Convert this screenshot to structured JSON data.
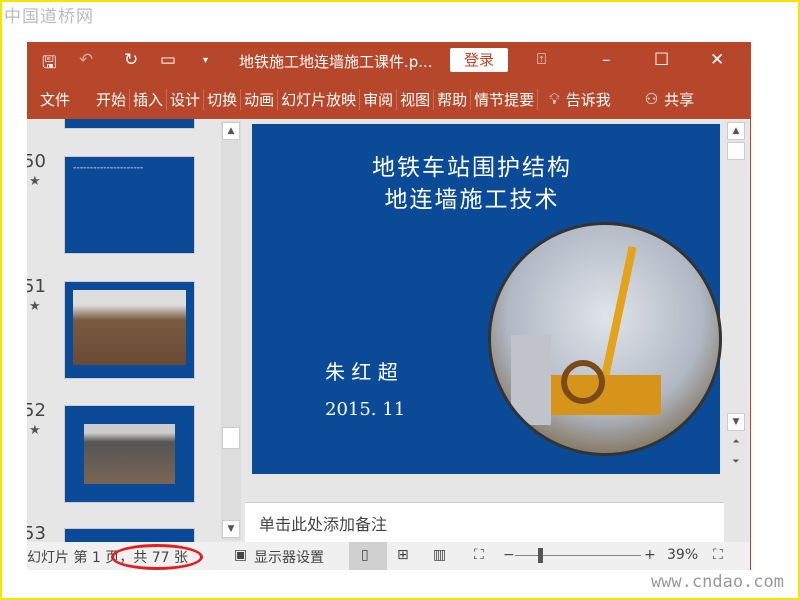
{
  "watermark_top": "中国道桥网",
  "watermark_bottom": "www.cndao.com",
  "titlebar": {
    "doc_title": "地铁施工地连墙施工课件.p...",
    "login": "登录"
  },
  "ribbon": {
    "tabs": [
      "文件",
      "开始",
      "插入",
      "设计",
      "切换",
      "动画",
      "幻灯片放映",
      "审阅",
      "视图",
      "帮助",
      "情节提要"
    ],
    "tell_me": "告诉我",
    "share": "共享"
  },
  "thumbnails": [
    {
      "number": "50"
    },
    {
      "number": "51"
    },
    {
      "number": "52"
    },
    {
      "number": "53"
    }
  ],
  "slide": {
    "title_line1": "地铁车站围护结构",
    "title_line2": "地连墙施工技术",
    "author": "朱 红 超",
    "date": "2015. 11"
  },
  "notes_placeholder": "单击此处添加备注",
  "status": {
    "slide_info": "幻灯片 第 1 页，共 77 张",
    "display_settings": "显示器设置",
    "zoom": "39%",
    "zoom_fraction": 0.39
  },
  "colors": {
    "accent": "#b7472a",
    "slide_bg": "#0b4a97",
    "annotation": "#e02020"
  }
}
